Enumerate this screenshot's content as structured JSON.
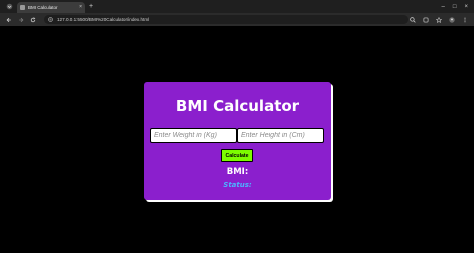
{
  "browser": {
    "tab_title": "BMI Calculator",
    "url": "127.0.0.1:5500/BMI%20Calculator/index.html",
    "new_tab_symbol": "+",
    "close_tab_symbol": "×",
    "window_controls": [
      "–",
      "□",
      "×"
    ]
  },
  "card": {
    "title": "BMI Calculator",
    "weight_input": {
      "value": "",
      "placeholder": "Enter Weight in (Kg)"
    },
    "height_input": {
      "value": "",
      "placeholder": "Enter Height in (Cm)"
    },
    "calculate_label": "Calculate",
    "bmi_label": "BMI:",
    "status_label": "Status:"
  },
  "colors": {
    "card_bg": "#8b1fcd",
    "button_bg": "#7cfc00",
    "status_text": "#4db2ff",
    "page_bg": "#000000"
  },
  "icons": {
    "toolbar_left": [
      "back-arrow-icon",
      "forward-arrow-icon",
      "reload-icon"
    ],
    "omnibox": "site-info-icon",
    "toolbar_right": [
      "zoom-icon",
      "share-icon",
      "star-icon",
      "profile-icon",
      "menu-dots-icon"
    ]
  }
}
